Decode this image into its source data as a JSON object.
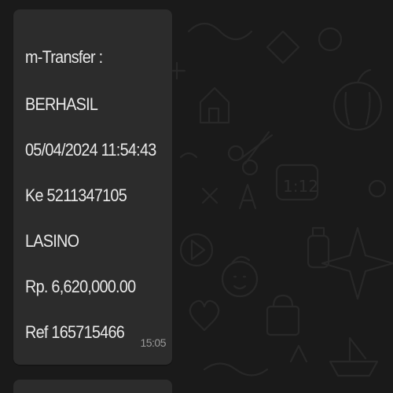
{
  "message": {
    "lines": [
      "m-Transfer :",
      "BERHASIL",
      "05/04/2024 11:54:43",
      "Ke 5211347105",
      "LASINO",
      "Rp. 6,620,000.00",
      "Ref 165715466"
    ],
    "time": "15:05"
  },
  "colors": {
    "chat_background": "#1a1a1a",
    "bubble": "#2c2c2c",
    "text": "#e9e9e9",
    "timestamp": "#9a9a9a"
  },
  "background_pattern": "doodle-wallpaper"
}
